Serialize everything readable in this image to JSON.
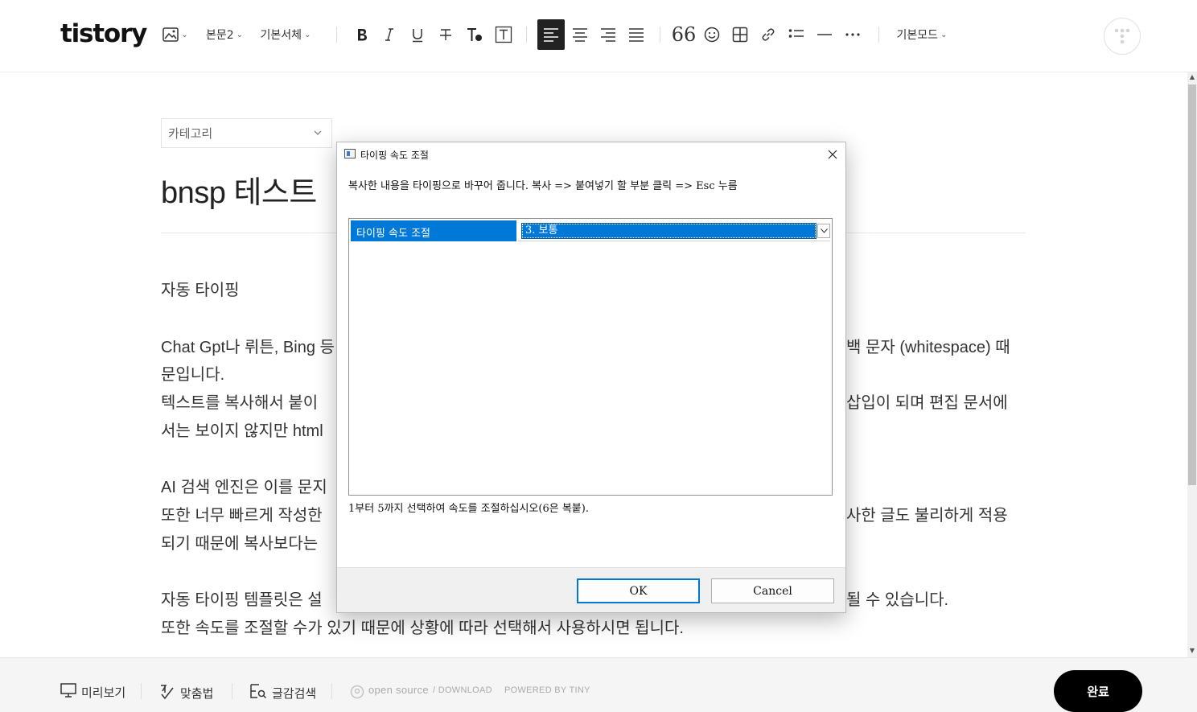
{
  "app": {
    "logo": "tistory"
  },
  "toolbar": {
    "image_icon": "image-icon",
    "paragraph_style": "본문2",
    "font_family": "기본서체",
    "mode": "기본모드",
    "buttons": [
      "bold-icon",
      "italic-icon",
      "underline-icon",
      "strikethrough-icon",
      "text-color-icon",
      "text-background-icon",
      "align-left-icon",
      "align-center-icon",
      "align-right-icon",
      "align-justify-icon",
      "quote-icon",
      "emoticon-icon",
      "table-icon",
      "link-icon",
      "list-icon",
      "divider-icon",
      "more-icon"
    ],
    "active_alignment": "left"
  },
  "editor": {
    "category_placeholder": "카테고리",
    "title": "bnsp 테스트",
    "paragraphs": [
      {
        "text": "자동 타이핑"
      },
      {
        "text": "Chat Gpt나 뤼튼, Bing 등"
      },
      {
        "text": "백 문자 (whitespace) 때"
      },
      {
        "text": "문입니다."
      },
      {
        "text": "텍스트를 복사해서 붙이"
      },
      {
        "text": "삽입이 되며 편집 문서에"
      },
      {
        "text": "서는 보이지 않지만 html"
      },
      {
        "text": "AI 검색 엔진은 이를 문지"
      },
      {
        "text": "또한 너무 빠르게 작성한"
      },
      {
        "text": "사한 글도 불리하게 적용"
      },
      {
        "text": "되기 때문에 복사보다는"
      },
      {
        "text": "자동 타이핑 템플릿은 설"
      },
      {
        "text": "될 수 있습니다."
      },
      {
        "text": "또한 속도를 조절할 수가 있기 때문에 상황에 따라 선택해서 사용하시면 됩니다."
      }
    ]
  },
  "bottom_bar": {
    "preview": "미리보기",
    "spellcheck": "맞춤법",
    "material_search": "글감검색",
    "open_source": "open source",
    "download": "/ DOWNLOAD",
    "powered_by": "POWERED BY TINY",
    "done": "완료"
  },
  "dialog": {
    "title": "타이핑 속도 조절",
    "description": "복사한 내용을 타이핑으로 바꾸어 줍니다. 복사 => 붙여넣기 할 부분 클릭 => Esc 누름",
    "property_label": "타이핑 속도 조절",
    "property_value": "3. 보통",
    "hint": "1부터 5까지 선택하여 속도를 조절하십시오(6은 복붙).",
    "ok": "OK",
    "cancel": "Cancel"
  },
  "colors": {
    "accent_blue": "#0078d7",
    "done_button": "#000000",
    "active_tool": "#222222"
  }
}
